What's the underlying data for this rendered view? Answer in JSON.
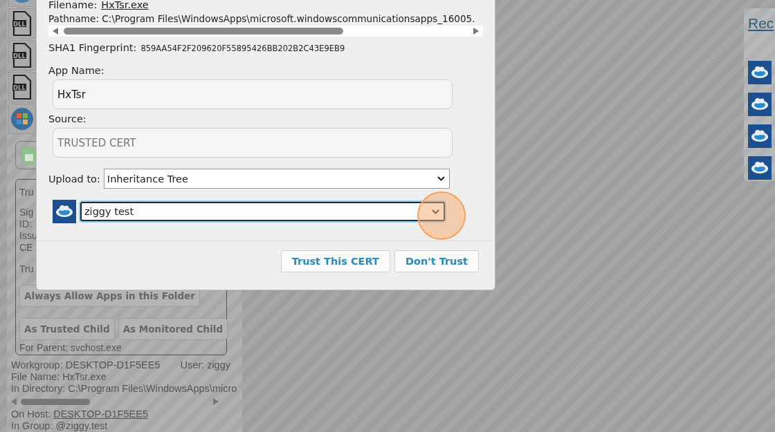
{
  "left_panel": {
    "icons": [
      {
        "kind": "orb"
      },
      {
        "kind": "dll",
        "label": "DLL"
      },
      {
        "kind": "dll",
        "label": "DLL"
      },
      {
        "kind": "dll",
        "label": "DLL"
      },
      {
        "kind": "windows"
      }
    ],
    "trust_box": {
      "lines": [
        "Tru",
        "Sig",
        "ID:",
        "Issu",
        "CE",
        "Tru"
      ],
      "folder_button": "Always Allow Apps in this Folder",
      "child_buttons": [
        "As Trusted Child",
        "As Monitored Child"
      ],
      "parent": "For Parent: svchost.exe"
    },
    "workgroup": "Workgroup: DESKTOP-D1F5EE5",
    "user": "User: ziggy",
    "file_name": "File Name: HxTsr.exe",
    "directory": "In Directory: C:\\Program Files\\WindowsApps\\micro",
    "host_label": "On Host:",
    "host": "DESKTOP-D1F5EE5",
    "group": "In Group: @ziggy.test"
  },
  "right_panel": {
    "link": "Rec",
    "icons": [
      {
        "kind": "cloud"
      },
      {
        "kind": "cloud"
      },
      {
        "kind": "cloud"
      },
      {
        "kind": "cloud"
      }
    ]
  },
  "dialog": {
    "filename_label": "Filename:",
    "filename": "HxTsr.exe",
    "pathname": "Pathname: C:\\Program Files\\WindowsApps\\microsoft.windowscommunicationsapps_16005.",
    "sha1_label": "SHA1 Fingerprint:",
    "sha1": "859AA54F2F209620F55895426BB202B2C43E9EB9",
    "app_name_label": "App Name:",
    "app_name": "HxTsr",
    "source_label": "Source:",
    "source": "TRUSTED CERT",
    "upload_label": "Upload to:",
    "upload_value": "Inheritance Tree",
    "group_value": "ziggy test",
    "group_focused": true,
    "buttons": [
      "Trust This CERT",
      "Don't Trust"
    ]
  }
}
